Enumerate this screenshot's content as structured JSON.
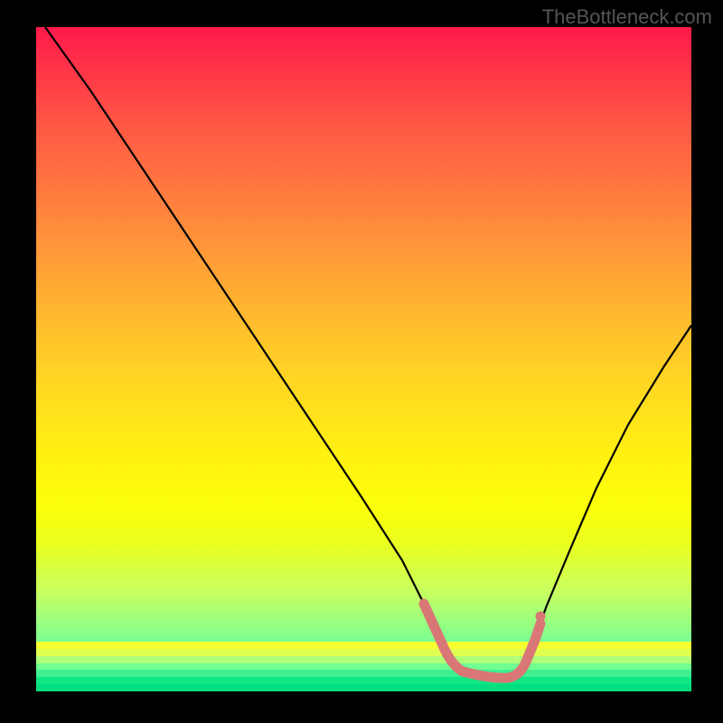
{
  "watermark": "TheBottleneck.com",
  "chart_data": {
    "type": "line",
    "title": "",
    "xlabel": "",
    "ylabel": "",
    "x": [
      0.0,
      0.05,
      0.1,
      0.15,
      0.2,
      0.25,
      0.3,
      0.35,
      0.4,
      0.45,
      0.5,
      0.55,
      0.6,
      0.63,
      0.67,
      0.7,
      0.74,
      0.78,
      0.82,
      0.86,
      0.9,
      0.95,
      1.0
    ],
    "values": [
      1.0,
      0.93,
      0.85,
      0.77,
      0.69,
      0.61,
      0.53,
      0.45,
      0.37,
      0.29,
      0.21,
      0.13,
      0.06,
      0.03,
      0.02,
      0.02,
      0.03,
      0.06,
      0.12,
      0.2,
      0.3,
      0.41,
      0.53
    ],
    "xlim": [
      0,
      1
    ],
    "ylim": [
      0,
      1
    ],
    "series": [
      {
        "name": "bottleneck-curve",
        "color": "#000000"
      }
    ],
    "highlight_region": {
      "x": [
        0.56,
        0.74
      ],
      "color": "#d97777"
    },
    "background_gradient": {
      "stops": [
        "#ff1a4a",
        "#ff5544",
        "#ff9938",
        "#ffd822",
        "#fcff08",
        "#c8ff60",
        "#00ee80"
      ]
    }
  }
}
